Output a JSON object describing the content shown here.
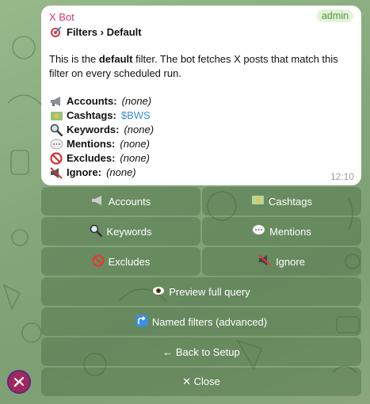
{
  "message": {
    "sender": "X Bot",
    "badge": "admin",
    "title": "Filters › Default",
    "desc_prefix": "This is the ",
    "desc_bold": "default",
    "desc_suffix": " filter. The bot fetches X posts that match this filter on every scheduled run.",
    "time": "12:10",
    "filters": [
      {
        "icon": "megaphone-icon",
        "label": "Accounts:",
        "value": "(none)"
      },
      {
        "icon": "money-icon",
        "label": "Cashtags:",
        "value": "$BWS"
      },
      {
        "icon": "magnifier-icon",
        "label": "Keywords:",
        "value": "(none)"
      },
      {
        "icon": "speech-bubble-icon",
        "label": "Mentions:",
        "value": "(none)"
      },
      {
        "icon": "no-entry-icon",
        "label": "Excludes:",
        "value": "(none)"
      },
      {
        "icon": "muted-speaker-icon",
        "label": "Ignore:",
        "value": "(none)"
      }
    ]
  },
  "keyboard": {
    "accounts": "Accounts",
    "cashtags": "Cashtags",
    "keywords": "Keywords",
    "mentions": "Mentions",
    "excludes": "Excludes",
    "ignore": "Ignore",
    "preview": "Preview full query",
    "named": "Named filters (advanced)",
    "back": "← Back to Setup",
    "close": "✕ Close"
  },
  "colors": {
    "sender": "#d23a6e",
    "badge_text": "#4f9a3f",
    "link": "#3a8be0",
    "avatar": "#a1285e"
  }
}
